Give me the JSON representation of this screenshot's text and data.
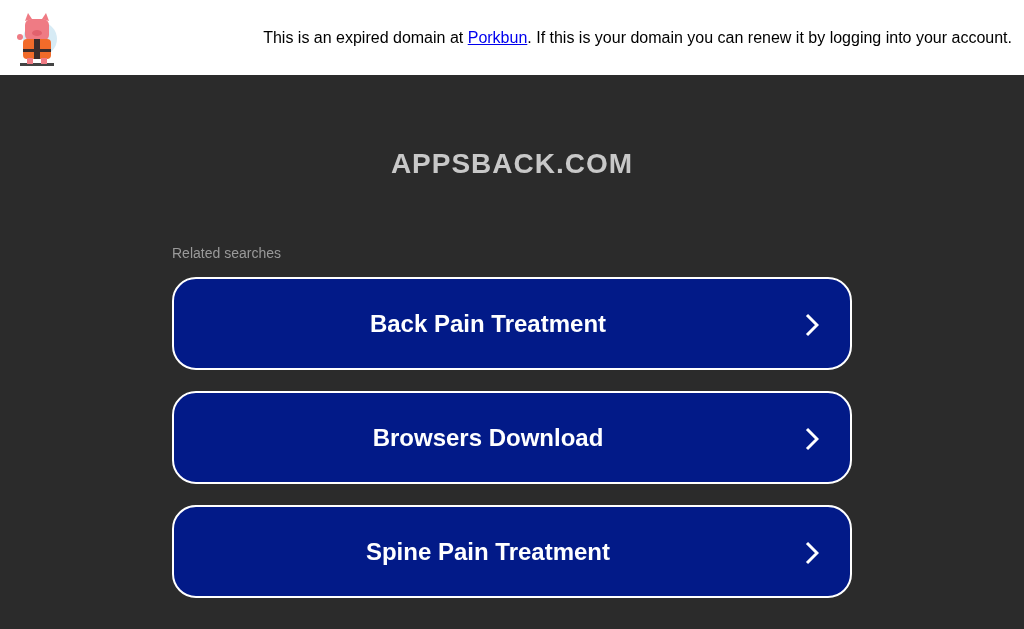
{
  "notice": {
    "before": "This is an expired domain at ",
    "link": "Porkbun",
    "after": ". If this is your domain you can renew it by logging into your account."
  },
  "domain_title": "APPSBACK.COM",
  "related": {
    "heading": "Related searches",
    "items": [
      {
        "label": "Back Pain Treatment"
      },
      {
        "label": "Browsers Download"
      },
      {
        "label": "Spine Pain Treatment"
      }
    ]
  }
}
